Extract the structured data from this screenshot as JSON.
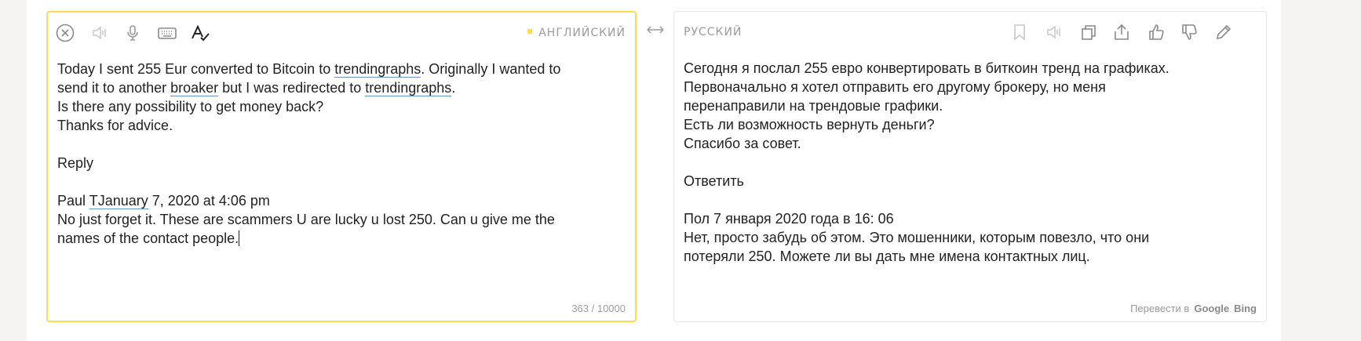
{
  "source": {
    "language": "АНГЛИЙСКИЙ",
    "lines": [
      [
        {
          "t": "Today I sent 255 Eur converted to Bitcoin to "
        },
        {
          "t": "trendingraphs",
          "u": true
        },
        {
          "t": ". Originally I wanted to"
        }
      ],
      [
        {
          "t": "send it to another "
        },
        {
          "t": "broaker",
          "u": true
        },
        {
          "t": " but I was redirected to "
        },
        {
          "t": "trendingraphs",
          "u": true
        },
        {
          "t": "."
        }
      ],
      [
        {
          "t": "Is there any possibility to get money back?"
        }
      ],
      [
        {
          "t": "Thanks for advice."
        }
      ],
      [
        {
          "t": ""
        }
      ],
      [
        {
          "t": "Reply"
        }
      ],
      [
        {
          "t": ""
        }
      ],
      [
        {
          "t": "Paul "
        },
        {
          "t": "TJanuary",
          "u": true
        },
        {
          "t": " 7, 2020 at 4:06 pm"
        }
      ],
      [
        {
          "t": "No just forget it. These are scammers U are lucky u lost 250. Can u give me the"
        }
      ],
      [
        {
          "t": "names of the contact people."
        }
      ]
    ],
    "counter": "363 / 10000"
  },
  "target": {
    "language": "РУССКИЙ",
    "lines": [
      "Сегодня я послал 255 евро конвертировать в биткоин тренд на графиках.",
      "Первоначально я хотел отправить его другому брокеру, но меня",
      "перенаправили на трендовые графики.",
      "Есть ли возможность вернуть деньги?",
      "Спасибо за совет.",
      "",
      "Ответить",
      "",
      "Пол 7 января 2020 года в 16: 06",
      "Нет, просто забудь об этом. Это мошенники, которым повезло, что они",
      "потеряли 250. Можете ли вы дать мне имена контактных лиц."
    ],
    "translate_in_label": "Перевести в",
    "services": [
      "Google",
      "Bing"
    ]
  },
  "icons": {
    "source_toolbar": [
      "clear-icon",
      "speaker-icon",
      "microphone-icon",
      "keyboard-icon",
      "spellcheck-icon"
    ],
    "target_toolbar": [
      "bookmark-icon",
      "speaker-icon",
      "copy-icon",
      "share-icon",
      "thumbs-up-icon",
      "thumbs-down-icon",
      "edit-icon"
    ],
    "swap": "swap-languages-icon"
  },
  "colors": {
    "accent": "#ffdb4d",
    "link_underline": "#6b8fc8",
    "icon_gray": "#9a9a9a",
    "icon_light": "#c8c8c8"
  }
}
